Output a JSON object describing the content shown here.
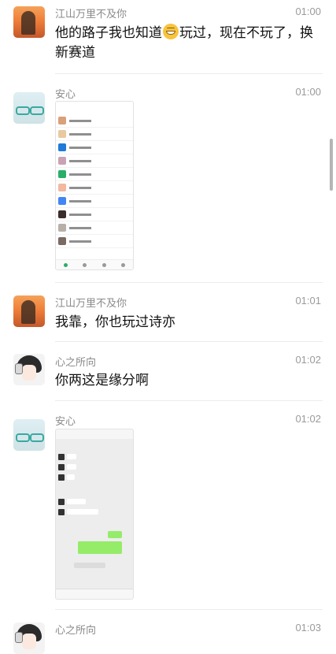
{
  "messages": [
    {
      "sender": "江山万里不及你",
      "time": "01:00",
      "text_before_emoji": "他的路子我也知道",
      "emoji": "grinning-emoji",
      "text_after_emoji": "玩过，现在不玩了，换新赛道"
    },
    {
      "sender": "安心",
      "time": "01:00",
      "image": "screenshot-chat-list"
    },
    {
      "sender": "江山万里不及你",
      "time": "01:01",
      "text": "我靠，你也玩过诗亦"
    },
    {
      "sender": "心之所向",
      "time": "01:02",
      "text": "你两这是缘分啊"
    },
    {
      "sender": "安心",
      "time": "01:02",
      "image": "screenshot-chat-window"
    },
    {
      "sender": "心之所向",
      "time": "01:03"
    }
  ],
  "colors": {
    "name": "#8a8a8a",
    "time": "#9a9a9a",
    "divider": "#ececec",
    "bubble_green": "#95ec69"
  }
}
